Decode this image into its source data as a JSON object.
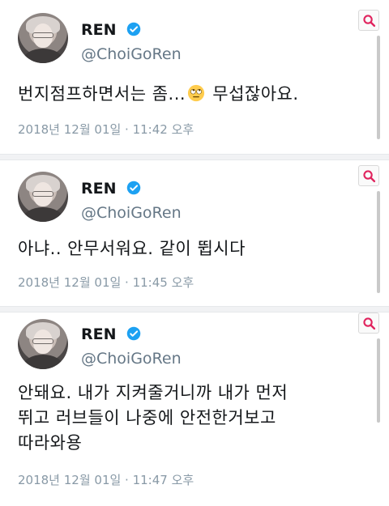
{
  "tweets": [
    {
      "name": "REN",
      "handle": "@ChoiGoRen",
      "text_before_emoji": "번지점프하면서는 좀...",
      "emoji": "rolling-eyes-emoji",
      "text_after_emoji": " 무섭잖아요.",
      "text_line2": "",
      "text_line3": "",
      "timestamp": "2018년 12월 01일 · 11:42 오후"
    },
    {
      "name": "REN",
      "handle": "@ChoiGoRen",
      "text_before_emoji": "아냐.. 안무서워요. 같이 뜁시다",
      "text_line2": "",
      "text_line3": "",
      "timestamp": "2018년 12월 01일 · 11:45 오후"
    },
    {
      "name": "REN",
      "handle": "@ChoiGoRen",
      "text_before_emoji": "안돼요. 내가 지켜줄거니까 내가 먼저",
      "text_line2": "뛰고 러브들이 나중에 안전한거보고",
      "text_line3": "따라와용",
      "timestamp": "2018년 12월 01일 · 11:47 오후"
    }
  ],
  "icons": {
    "verified": "verified-badge-icon",
    "search": "search-icon"
  },
  "colors": {
    "verified": "#1da1f2",
    "search": "#e0245e",
    "handle": "#657786",
    "meta": "#8899a6"
  }
}
